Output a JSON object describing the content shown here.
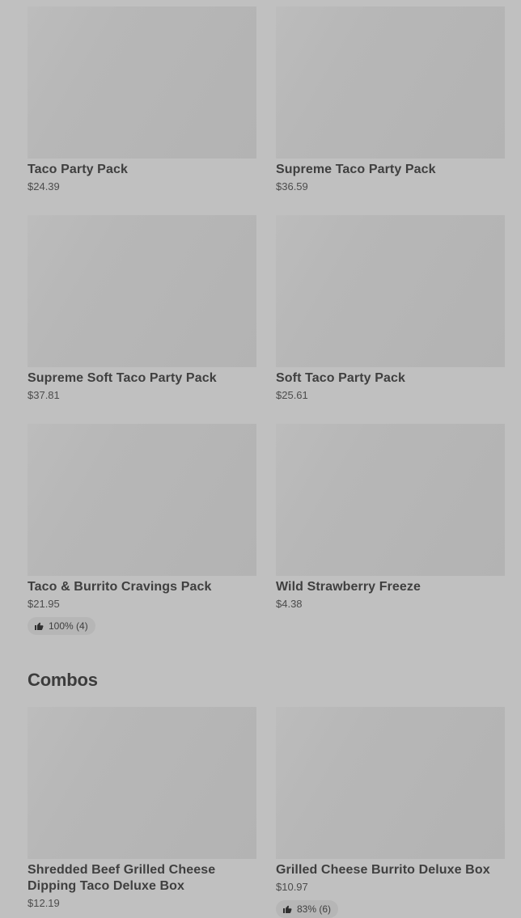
{
  "party_packs": [
    {
      "title": "Taco Party Pack",
      "price": "$24.39"
    },
    {
      "title": "Supreme Taco Party Pack",
      "price": "$36.59"
    },
    {
      "title": "Supreme Soft Taco Party Pack",
      "price": "$37.81"
    },
    {
      "title": "Soft Taco Party Pack",
      "price": "$25.61"
    },
    {
      "title": "Taco & Burrito Cravings Pack",
      "price": "$21.95",
      "rating": "100% (4)"
    },
    {
      "title": "Wild Strawberry Freeze",
      "price": "$4.38"
    }
  ],
  "combos": {
    "section_title": "Combos",
    "items": [
      {
        "title": "Shredded Beef Grilled Cheese Dipping Taco Deluxe Box",
        "price": "$12.19"
      },
      {
        "title": "Grilled Cheese Burrito Deluxe Box",
        "price": "$10.97",
        "rating": "83% (6)"
      }
    ]
  },
  "icons": {
    "rating": "thumbs-up-icon"
  }
}
